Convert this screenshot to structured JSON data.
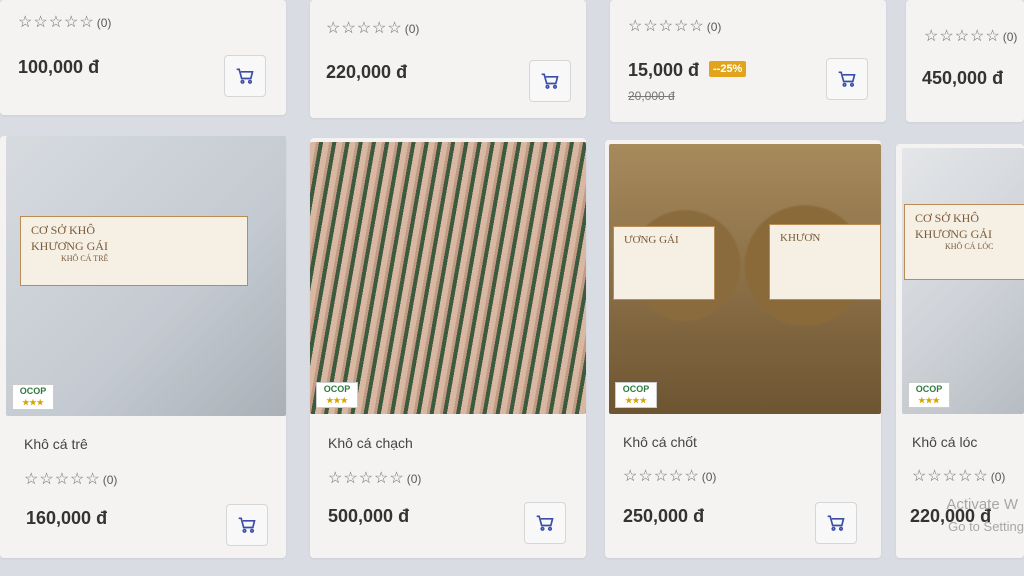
{
  "top_row": [
    {
      "rating_count": "(0)",
      "price": "100,000 đ"
    },
    {
      "rating_count": "(0)",
      "price": "220,000 đ"
    },
    {
      "rating_count": "(0)",
      "price": "15,000 đ",
      "discount": "--25%",
      "old_price": "20,000 đ"
    },
    {
      "rating_count": "(0)",
      "price": "450,000 đ"
    }
  ],
  "bottom_row": [
    {
      "name": "Khô cá trê",
      "rating_count": "(0)",
      "price": "160,000 đ",
      "sticker": {
        "line1": "CƠ SỞ KHÔ",
        "line2": "KHƯƠNG GÁI",
        "line3": "KHÔ CÁ TRÊ"
      }
    },
    {
      "name": "Khô cá chạch",
      "rating_count": "(0)",
      "price": "500,000 đ"
    },
    {
      "name": "Khô cá chốt",
      "rating_count": "(0)",
      "price": "250,000 đ",
      "sticker": {
        "left": "ƯƠNG GÁI",
        "right": "KHƯƠN"
      }
    },
    {
      "name": "Khô cá lóc",
      "rating_count": "(0)",
      "price": "220,000 đ",
      "sticker": {
        "line1": "CƠ SỞ KHÔ",
        "line2": "KHƯƠNG GẢI",
        "line3": "KHÔ CÁ LÓC"
      }
    }
  ],
  "ocop": {
    "label": "OCOP",
    "stars": "★★★"
  },
  "stars_glyph": "☆☆☆☆☆",
  "watermark": {
    "line1": "Activate W",
    "line2": "Go to Setting"
  },
  "colors": {
    "discount": "#e0a51d",
    "background": "#d9dde3",
    "card": "#f4f3f1"
  }
}
